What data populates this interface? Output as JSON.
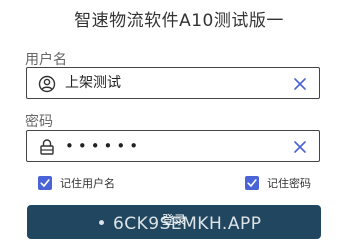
{
  "app": {
    "title": "智速物流软件A10测试版一"
  },
  "username": {
    "label": "用户名",
    "value": "上架测试",
    "icon": "user-circle-icon",
    "clear_icon": "clear-icon"
  },
  "password": {
    "label": "密码",
    "value": "••••••",
    "icon": "lock-icon",
    "clear_icon": "clear-icon"
  },
  "options": {
    "remember_user_label": "记住用户名",
    "remember_user_checked": true,
    "remember_password_label": "记住密码",
    "remember_password_checked": true
  },
  "login_button": {
    "label": "登录"
  },
  "watermark": {
    "text": "• 6CK9SEMKH.APP"
  },
  "colors": {
    "accent": "#4a63d6",
    "button": "#20475f",
    "border": "#444444",
    "text": "#333333"
  }
}
